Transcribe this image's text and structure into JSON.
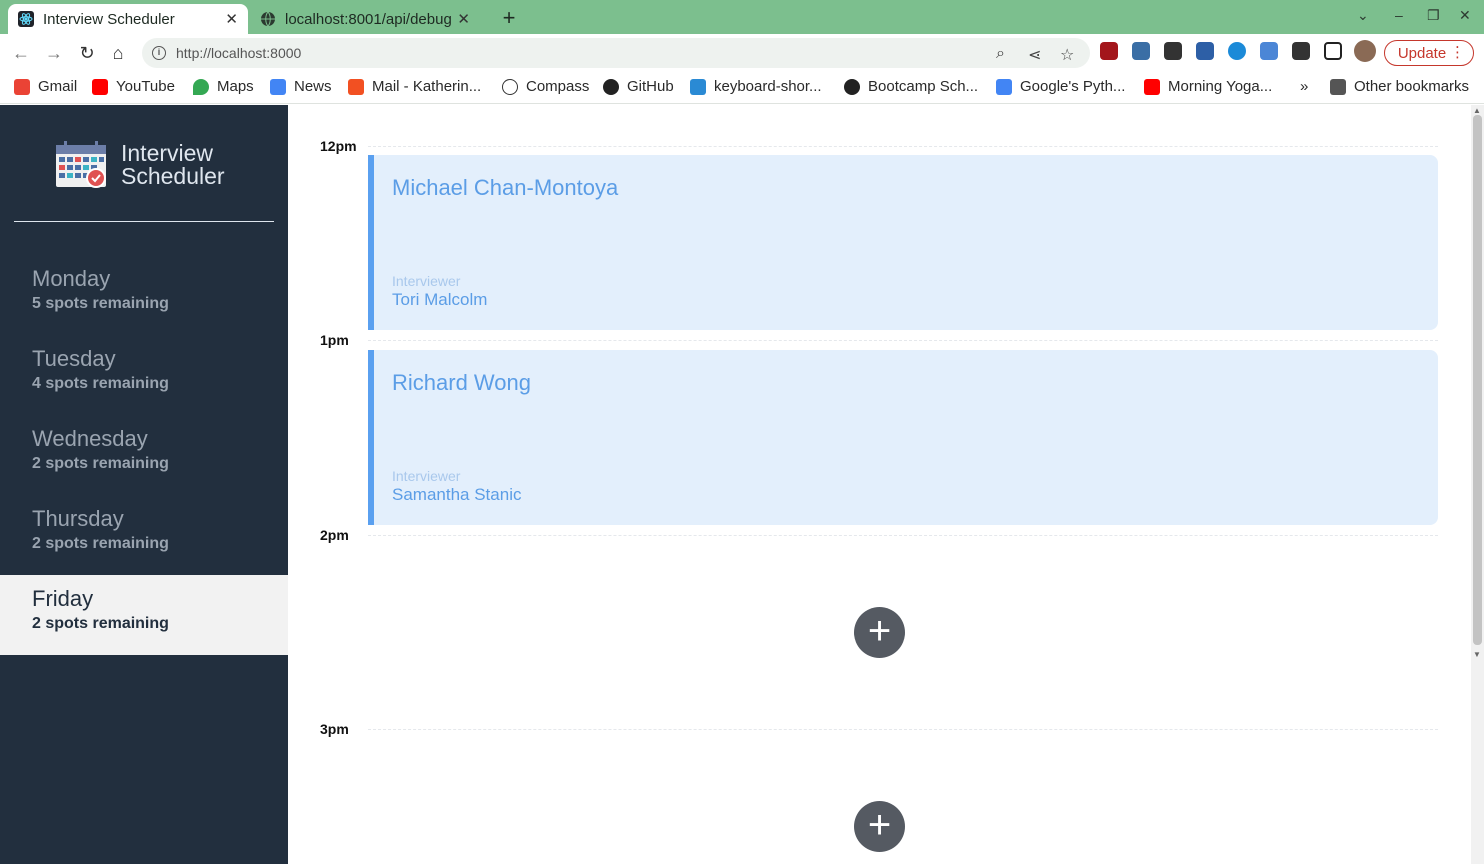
{
  "browser": {
    "tabs": [
      {
        "title": "Interview Scheduler",
        "active": true
      },
      {
        "title": "localhost:8001/api/debug",
        "active": false
      }
    ],
    "url": "http://localhost:8000",
    "update_label": "Update",
    "bookmarks": [
      "Gmail",
      "YouTube",
      "Maps",
      "News",
      "Mail - Katherin...",
      "Compass",
      "GitHub",
      "keyboard-shor...",
      "Bootcamp Sch...",
      "Google's Pyth...",
      "Morning Yoga...",
      "»",
      "Other bookmarks"
    ]
  },
  "app": {
    "logo_line1": "Interview",
    "logo_line2": "Scheduler",
    "days": [
      {
        "name": "Monday",
        "spots": "5 spots remaining",
        "selected": false
      },
      {
        "name": "Tuesday",
        "spots": "4 spots remaining",
        "selected": false
      },
      {
        "name": "Wednesday",
        "spots": "2 spots remaining",
        "selected": false
      },
      {
        "name": "Thursday",
        "spots": "2 spots remaining",
        "selected": false
      },
      {
        "name": "Friday",
        "spots": "2 spots remaining",
        "selected": true
      }
    ],
    "slots": [
      {
        "time": "12pm",
        "student": "Michael Chan-Montoya",
        "interviewer_label": "Interviewer",
        "interviewer": "Tori Malcolm"
      },
      {
        "time": "1pm",
        "student": "Richard Wong",
        "interviewer_label": "Interviewer",
        "interviewer": "Samantha Stanic"
      },
      {
        "time": "2pm"
      },
      {
        "time": "3pm"
      }
    ]
  },
  "colors": {
    "sidebar": "#222f3e",
    "accent": "#5aa0f0",
    "appointment_bg": "#e3effc",
    "tab_strip": "#7cbf8e"
  }
}
